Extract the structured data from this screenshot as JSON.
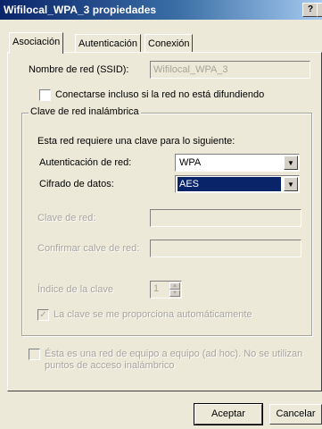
{
  "window": {
    "title": "Wifilocal_WPA_3 propiedades",
    "help_btn": "?",
    "close_btn": "×"
  },
  "tabs": [
    {
      "label": "Asociación"
    },
    {
      "label": "Autenticación"
    },
    {
      "label": "Conexión"
    }
  ],
  "association": {
    "ssid_label": "Nombre de red (SSID):",
    "ssid_value": "Wifilocal_WPA_3",
    "broadcast_check_label": "Conectarse incluso si la red no está difundiendo",
    "broadcast_checked": false,
    "group_title": "Clave de red inalámbrica",
    "requires_text": "Esta red requiere una clave para lo siguiente:",
    "auth_label": "Autenticación de red:",
    "auth_value": "WPA",
    "cipher_label": "Cifrado de datos:",
    "cipher_value": "AES",
    "key_label": "Clave de red:",
    "key_value": "",
    "confirm_label": "Confirmar calve de red:",
    "confirm_value": "",
    "index_label": "Índice de la clave",
    "index_value": "1",
    "auto_key_label": "La clave se me proporciona automáticamente",
    "auto_key_checked": true,
    "adhoc_label_line1": "Ésta es una red de equipo a equipo (ad hoc). No se utilizan",
    "adhoc_label_line2": "puntos de acceso inalámbrico",
    "adhoc_checked": false
  },
  "buttons": {
    "ok": "Aceptar",
    "cancel": "Cancelar"
  },
  "icons": {
    "spin_up": "▲",
    "spin_down": "▼",
    "dropdown": "▼",
    "check": "✓"
  }
}
